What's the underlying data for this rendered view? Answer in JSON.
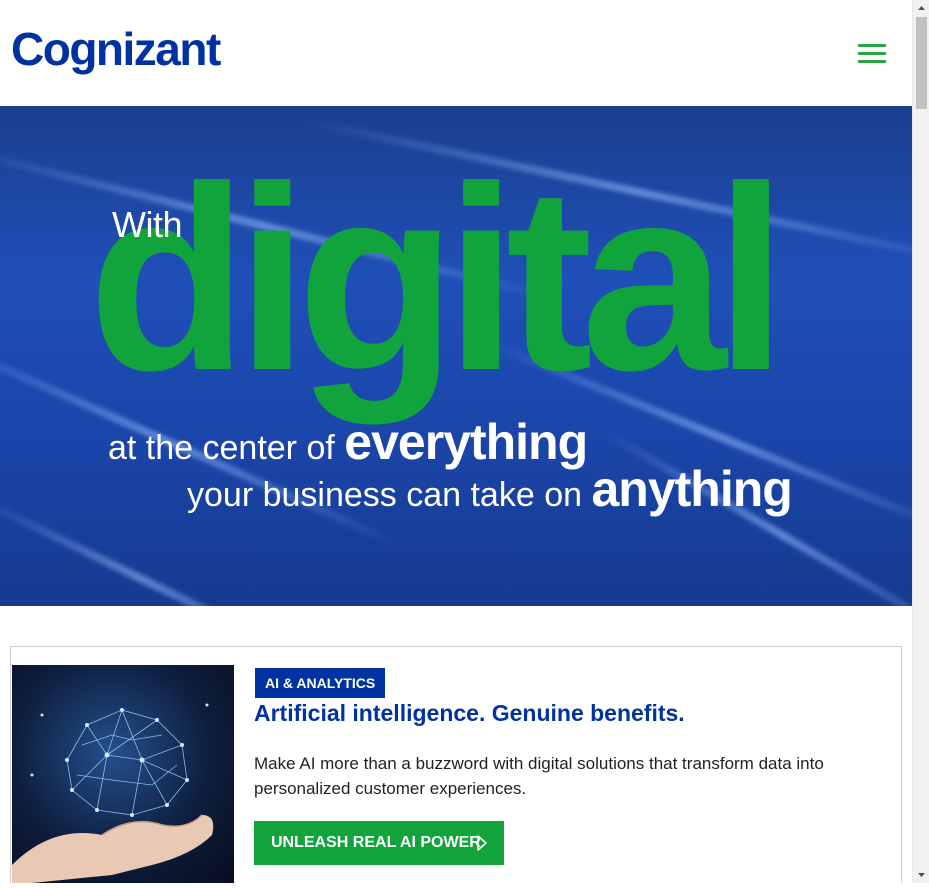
{
  "header": {
    "logo_text": "Cognizant",
    "menu_icon": "hamburger-menu-icon"
  },
  "hero": {
    "with": "With",
    "digital": "digital",
    "line1_prefix": "at the center of ",
    "line1_emphasis": "everything",
    "line2_prefix": "your business can take on ",
    "line2_emphasis": "anything"
  },
  "card": {
    "tag": "AI & ANALYTICS",
    "title": "Artificial intelligence. Genuine benefits.",
    "description": "Make AI more than a buzzword with digital solutions that transform data into personalized customer experiences.",
    "cta_label": "UNLEASH REAL AI POWER",
    "cta_icon": "play-arrow-icon",
    "image_icon": "ai-brain-hand-image"
  },
  "colors": {
    "brand_blue": "#0033a1",
    "brand_green": "#12a43c",
    "hero_bg": "#1f4fb8"
  }
}
